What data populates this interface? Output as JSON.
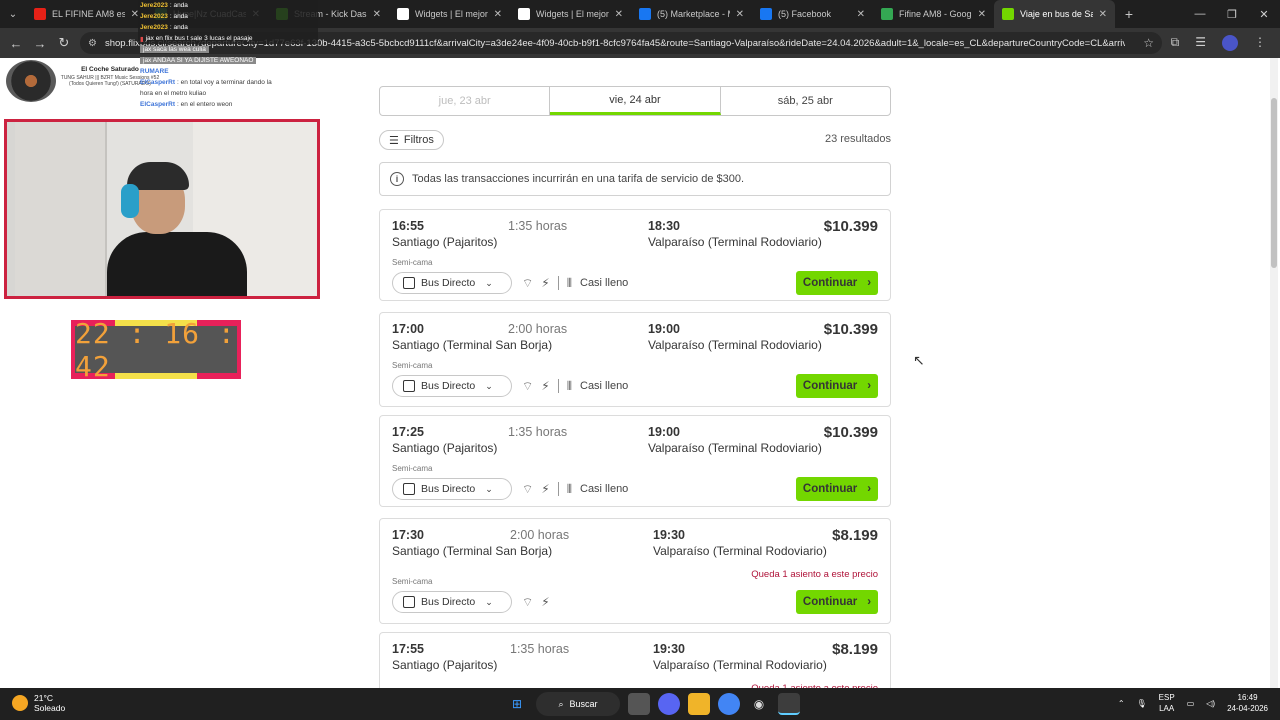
{
  "browser": {
    "tabs": [
      {
        "title": "EL FIFINE AM8 es el M",
        "icon": "youtube-icon",
        "color": "#e62117"
      },
      {
        "title": "Hype|Nz CuadCast: ja",
        "icon": "music-icon",
        "color": "#2ca04a"
      },
      {
        "title": "Stream - Kick Dashbo",
        "icon": "kick-icon",
        "color": "#53fc18"
      },
      {
        "title": "Widgets | El mejor so",
        "icon": "diamond-icon",
        "color": "#ffffff"
      },
      {
        "title": "Widgets | El mejor so",
        "icon": "diamond-icon",
        "color": "#ffffff"
      },
      {
        "title": "(5) Marketplace - Mi",
        "icon": "facebook-icon",
        "color": "#1877f2"
      },
      {
        "title": "(5) Facebook",
        "icon": "facebook-icon",
        "color": "#1877f2"
      },
      {
        "title": "Fifine AM8 - Google",
        "icon": "sheets-icon",
        "color": "#34a853"
      },
      {
        "title": "Viaje en bus de Santi",
        "icon": "flixbus-icon",
        "color": "#73d700",
        "active": true
      }
    ],
    "url": "shop.flixbus.cl/search?departureCity=1d77e63f-130b-4415-a3c5-5bcbcd9111cf&arrivalCity=a3de24ee-4f09-40cb-b9f1-8cfc9764fa45&route=Santiago-Valparaíso&rideDate=24.04.2026&adult=1&_locale=es_CL&departureCountryCode=CL&arrivalC..."
  },
  "stream_overlay": {
    "now_playing_name": "El Coche Saturado",
    "now_playing_track": "TUNG SAHUR ||| BZRT Music Sessions #52 (Todos Quieren Tung!) (SATURADO)",
    "chat": [
      {
        "user": "Jere2023",
        "text": ": anda"
      },
      {
        "user": "Jere2023",
        "text": ": anda"
      },
      {
        "user": "Jere2023",
        "text": ": anda"
      },
      {
        "user": "",
        "text": "jax en flix bus t sale 3 lucas el pasaje"
      },
      {
        "user": "",
        "text": "jax saca las wea culia"
      },
      {
        "user": "",
        "text": "jax ANDAA SI YA DIJISTE AWEONAO"
      },
      {
        "user": "RUMARE",
        "text": ""
      },
      {
        "user": "ElCasperRt",
        "text": ": en total voy a terminar dando la"
      },
      {
        "user": "",
        "text": "hora en el metro kuliao"
      },
      {
        "user": "ElCasperRt",
        "text": ": en el entero weon"
      }
    ],
    "timer": "22 : 16 : 42"
  },
  "search": {
    "dates": [
      {
        "label": "jue, 23 abr",
        "state": "disabled"
      },
      {
        "label": "vie, 24 abr",
        "state": "selected"
      },
      {
        "label": "sáb, 25 abr",
        "state": "normal"
      }
    ],
    "filters_label": "Filtros",
    "results_count": "23 resultados",
    "notice": "Todas las transacciones incurrirán en una tarifa de servicio de $300."
  },
  "results": [
    {
      "dep": "16:55",
      "dur": "1:35 horas",
      "arr": "18:30",
      "price": "$10.399",
      "from": "Santiago (Pajaritos)",
      "to": "Valparaíso (Terminal Rodoviario)",
      "seat": "Semi-cama",
      "bus": "Bus Directo",
      "status": "Casi lleno",
      "warn": "",
      "cta": "Continuar"
    },
    {
      "dep": "17:00",
      "dur": "2:00 horas",
      "arr": "19:00",
      "price": "$10.399",
      "from": "Santiago (Terminal San Borja)",
      "to": "Valparaíso (Terminal Rodoviario)",
      "seat": "Semi-cama",
      "bus": "Bus Directo",
      "status": "Casi lleno",
      "warn": "",
      "cta": "Continuar"
    },
    {
      "dep": "17:25",
      "dur": "1:35 horas",
      "arr": "19:00",
      "price": "$10.399",
      "from": "Santiago (Pajaritos)",
      "to": "Valparaíso (Terminal Rodoviario)",
      "seat": "Semi-cama",
      "bus": "Bus Directo",
      "status": "Casi lleno",
      "warn": "",
      "cta": "Continuar"
    },
    {
      "dep": "17:30",
      "dur": "2:00 horas",
      "arr": "19:30",
      "price": "$8.199",
      "from": "Santiago (Terminal San Borja)",
      "to": "Valparaíso (Terminal Rodoviario)",
      "seat": "Semi-cama",
      "bus": "Bus Directo",
      "status": "",
      "warn": "Queda 1 asiento a este precio",
      "cta": "Continuar"
    },
    {
      "dep": "17:55",
      "dur": "1:35 horas",
      "arr": "19:30",
      "price": "$8.199",
      "from": "Santiago (Pajaritos)",
      "to": "Valparaíso (Terminal Rodoviario)",
      "seat": "",
      "bus": "",
      "status": "",
      "warn": "Queda 1 asiento a este precio",
      "cta": ""
    }
  ],
  "taskbar": {
    "temp": "21°C",
    "weather": "Soleado",
    "search_label": "Buscar",
    "lang_1": "ESP",
    "lang_2": "LAA",
    "time": "16:49",
    "date": "24-04-2026"
  },
  "colors": {
    "accent": "#73d700",
    "warning": "#b0143a",
    "overlay_border": "#cc2240"
  }
}
